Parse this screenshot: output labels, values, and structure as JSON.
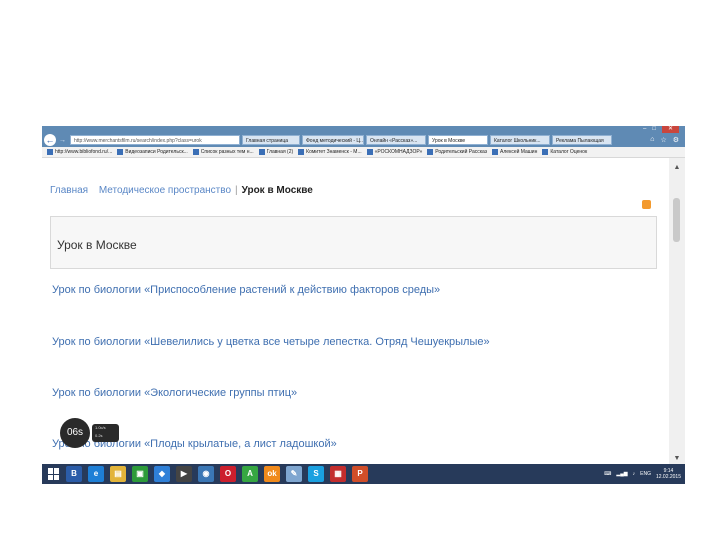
{
  "browser": {
    "address": "http://www.merchantsfilm.ru/search/index.php?class=urok",
    "tabs": [
      {
        "label": "Главная страница"
      },
      {
        "label": "Фонд методический - Ц..."
      },
      {
        "label": "Онлайн «Рассказ»..."
      },
      {
        "label": "Урок в Москве",
        "active": true
      },
      {
        "label": "Каталог Школьник..."
      },
      {
        "label": "Реклама Пылающая"
      }
    ],
    "back_glyph": "←",
    "forward_glyph": "→",
    "window_buttons": [
      "–",
      "□",
      "✕"
    ],
    "nav_icons": [
      "⌂",
      "☆",
      "⚙"
    ],
    "favorites": [
      "http://www.bibliofond.ru/...",
      "Видеозаписи Родительск...",
      "Список разных тем н...",
      "Главная (2)",
      "Комитет Знаменск - М...",
      "«РОСКОМНАДЗОР»",
      "Родительский Рассказ",
      "Алексей Машин",
      "Каталог Оценок"
    ]
  },
  "breadcrumb": {
    "home": "Главная",
    "section": "Методическое пространство",
    "separator": "|",
    "current": "Урок в Москве"
  },
  "page_title": "Урок в Москве",
  "lessons": [
    "Урок по биологии «Приспособление растений к действию факторов среды»",
    "Урок по биологии «Шевелились у цветка все четыре лепестка. Отряд Чешуекрылые»",
    "Урок по биологии «Экологические группы птиц»",
    "Урок по биологии «Плоды крылатые, а лист ладошкой»"
  ],
  "recorder": {
    "count": "06s",
    "line1": "1.0c/s",
    "line2": "0.2s"
  },
  "taskbar": {
    "apps": [
      {
        "icon": "word-icon",
        "glyph": "В",
        "color": "#2b5ca8"
      },
      {
        "icon": "ie-icon",
        "glyph": "e",
        "color": "#1e7fd6"
      },
      {
        "icon": "explorer-icon",
        "glyph": "▤",
        "color": "#e2b43a"
      },
      {
        "icon": "store-icon",
        "glyph": "▣",
        "color": "#2d9b3a"
      },
      {
        "icon": "dropbox-icon",
        "glyph": "◆",
        "color": "#2f80d8"
      },
      {
        "icon": "media-icon",
        "glyph": "▶",
        "color": "#444444"
      },
      {
        "icon": "camera-icon",
        "glyph": "◉",
        "color": "#3b77b5"
      },
      {
        "icon": "opera-icon",
        "glyph": "O",
        "color": "#cc1f2d"
      },
      {
        "icon": "abbyy-icon",
        "glyph": "A",
        "color": "#36a742"
      },
      {
        "icon": "odnoklassniki-icon",
        "glyph": "ok",
        "color": "#f08a1c"
      },
      {
        "icon": "paint-icon",
        "glyph": "✎",
        "color": "#7fa6d0"
      },
      {
        "icon": "skype-icon",
        "glyph": "S",
        "color": "#1aa0e0"
      },
      {
        "icon": "pdf-icon",
        "glyph": "▦",
        "color": "#c32d2d"
      },
      {
        "icon": "powerpoint-icon",
        "glyph": "P",
        "color": "#d04e29"
      }
    ],
    "lang": "ENG",
    "time": "9:14",
    "date": "12.02.2015"
  }
}
